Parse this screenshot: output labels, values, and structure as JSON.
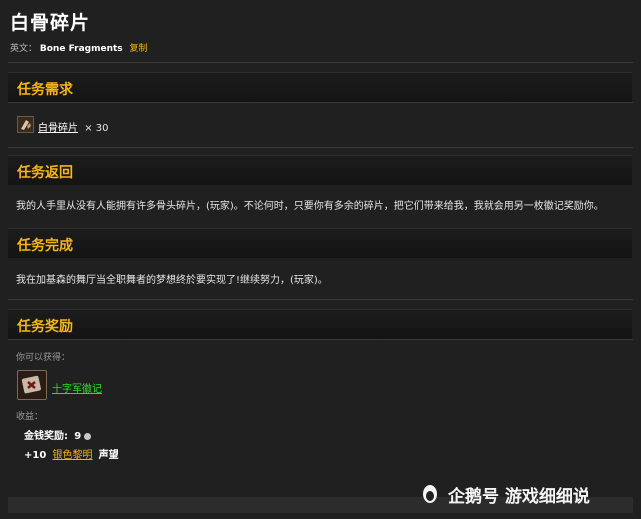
{
  "header": {
    "title": "白骨碎片",
    "english_label": "英文：",
    "english_name": "Bone Fragments",
    "copy_label": "复制"
  },
  "requirements": {
    "section_title": "任务需求",
    "item_name": "白骨碎片",
    "item_qty": "× 30"
  },
  "progress": {
    "section_title": "任务返回",
    "text": "我的人手里从没有人能拥有许多骨头碎片，(玩家)。不论何时，只要你有多余的碎片，把它们带来给我，我就会用另一枚徽记奖励你。"
  },
  "completion": {
    "section_title": "任务完成",
    "text": "我在加基森的舞厅当全职舞者的梦想终於要实现了!继续努力，(玩家)。"
  },
  "rewards": {
    "section_title": "任务奖励",
    "receive_label": "你可以获得：",
    "item_name": "十字军徽记",
    "gains_label": "收益：",
    "money_label": "金钱奖励:",
    "money_value": "9",
    "rep_prefix": "+10",
    "rep_faction": "银色黎明",
    "rep_suffix": "声望"
  },
  "watermark": {
    "text": "企鹅号 游戏细细说"
  },
  "colors": {
    "accent": "#f5b617",
    "green_link": "#28e028",
    "background": "#202020"
  }
}
